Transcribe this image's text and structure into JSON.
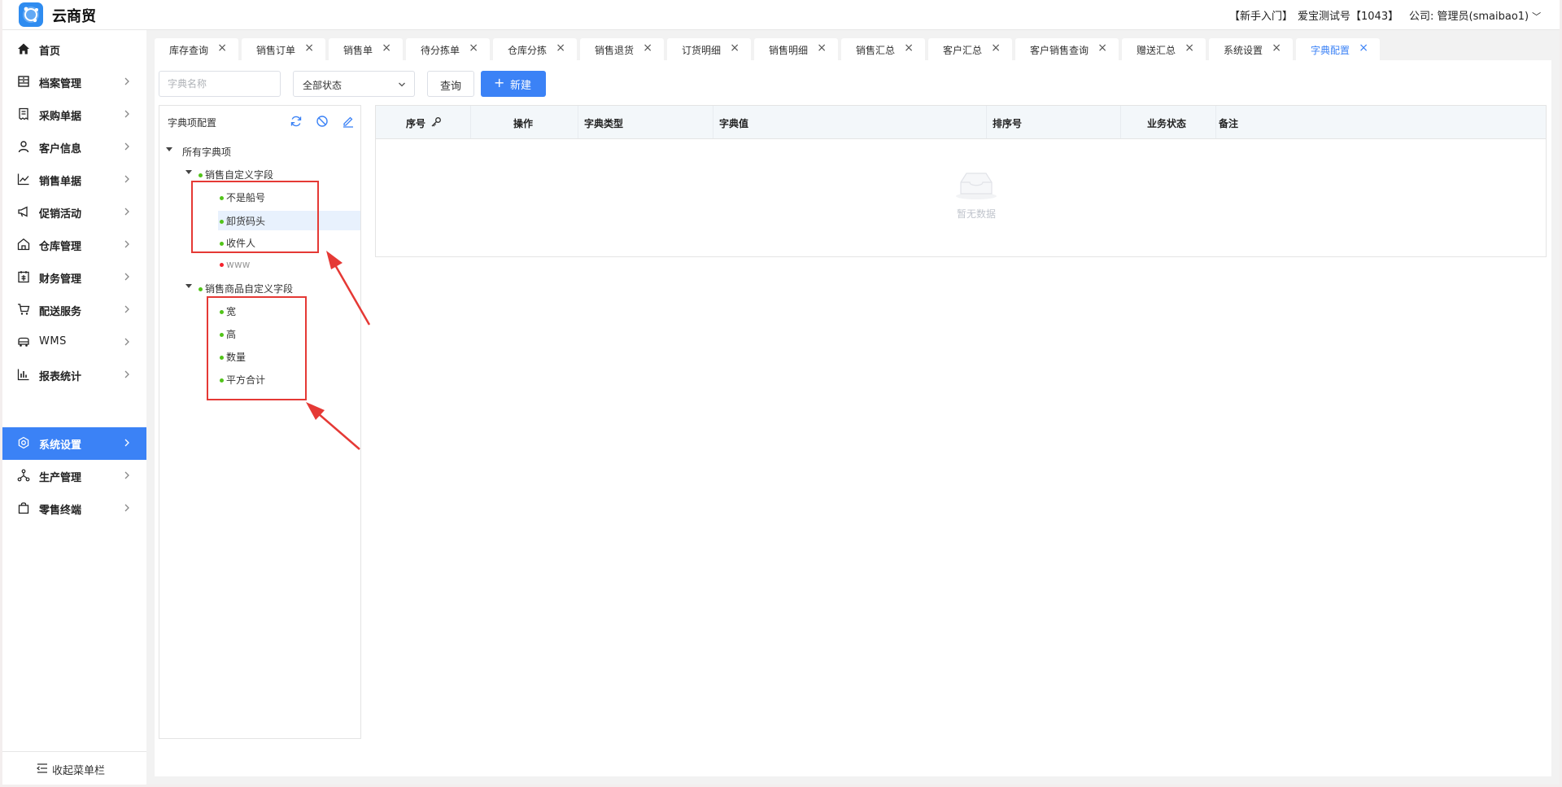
{
  "app": {
    "title": "云商贸"
  },
  "header": {
    "guide": "【新手入门】",
    "account": "爱宝测试号【1043】",
    "company": "公司: 管理员(smaibao1)"
  },
  "sidebar": {
    "items": [
      {
        "label": "首页",
        "icon": "home-icon"
      },
      {
        "label": "档案管理",
        "icon": "archive-icon"
      },
      {
        "label": "采购单据",
        "icon": "purchase-doc-icon"
      },
      {
        "label": "客户信息",
        "icon": "user-icon"
      },
      {
        "label": "销售单据",
        "icon": "chart-icon"
      },
      {
        "label": "促销活动",
        "icon": "megaphone-icon"
      },
      {
        "label": "仓库管理",
        "icon": "warehouse-icon"
      },
      {
        "label": "财务管理",
        "icon": "finance-icon"
      },
      {
        "label": "配送服务",
        "icon": "cart-icon"
      },
      {
        "label": "WMS",
        "icon": "truck-icon"
      },
      {
        "label": "报表统计",
        "icon": "bar-chart-icon"
      },
      {
        "label": "系统设置",
        "icon": "gear-icon",
        "active": true
      },
      {
        "label": "生产管理",
        "icon": "network-icon"
      },
      {
        "label": "零售终端",
        "icon": "bag-icon"
      }
    ],
    "collapse_label": "收起菜单栏"
  },
  "tabs": [
    {
      "label": "库存查询"
    },
    {
      "label": "销售订单"
    },
    {
      "label": "销售单"
    },
    {
      "label": "待分拣单"
    },
    {
      "label": "仓库分拣"
    },
    {
      "label": "销售退货"
    },
    {
      "label": "订货明细"
    },
    {
      "label": "销售明细"
    },
    {
      "label": "销售汇总"
    },
    {
      "label": "客户汇总"
    },
    {
      "label": "客户销售查询"
    },
    {
      "label": "赠送汇总"
    },
    {
      "label": "系统设置"
    },
    {
      "label": "字典配置",
      "active": true
    }
  ],
  "toolbar": {
    "search_placeholder": "字典名称",
    "status_value": "全部状态",
    "query_label": "查询",
    "new_label": "新建"
  },
  "tree": {
    "title": "字典项配置",
    "root": "所有字典项",
    "groups": [
      {
        "label": "销售自定义字段",
        "children": [
          {
            "label": "不是船号",
            "status": "green"
          },
          {
            "label": "卸货码头",
            "status": "green",
            "selected": true
          },
          {
            "label": "收件人",
            "status": "green"
          },
          {
            "label": "www",
            "status": "red"
          }
        ]
      },
      {
        "label": "销售商品自定义字段",
        "children": [
          {
            "label": "宽",
            "status": "green"
          },
          {
            "label": "高",
            "status": "green"
          },
          {
            "label": "数量",
            "status": "green"
          },
          {
            "label": "平方合计",
            "status": "green"
          }
        ]
      }
    ]
  },
  "table": {
    "columns": [
      "序号",
      "操作",
      "字典类型",
      "字典值",
      "排序号",
      "业务状态",
      "备注"
    ],
    "empty_text": "暂无数据"
  },
  "colors": {
    "accent": "#3b82f6",
    "annotation": "#e53935",
    "ok": "#52c41a",
    "error": "#f5222d"
  }
}
